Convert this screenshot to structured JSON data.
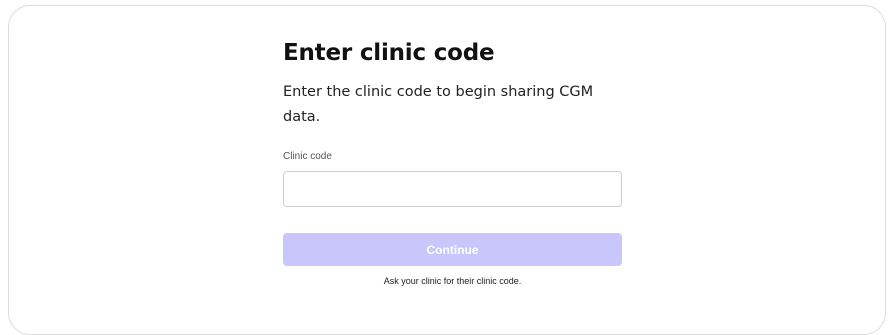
{
  "page": {
    "title": "Enter clinic code",
    "subtitle": "Enter the clinic code to begin sharing CGM data."
  },
  "form": {
    "clinic_code": {
      "label": "Clinic code",
      "value": "",
      "placeholder": ""
    },
    "continue_label": "Continue",
    "continue_disabled": true,
    "hint": "Ask your clinic for their clinic code."
  },
  "colors": {
    "button_disabled_bg": "#c8c6fa",
    "button_text": "#ffffff",
    "card_border": "#dcdcdc"
  }
}
